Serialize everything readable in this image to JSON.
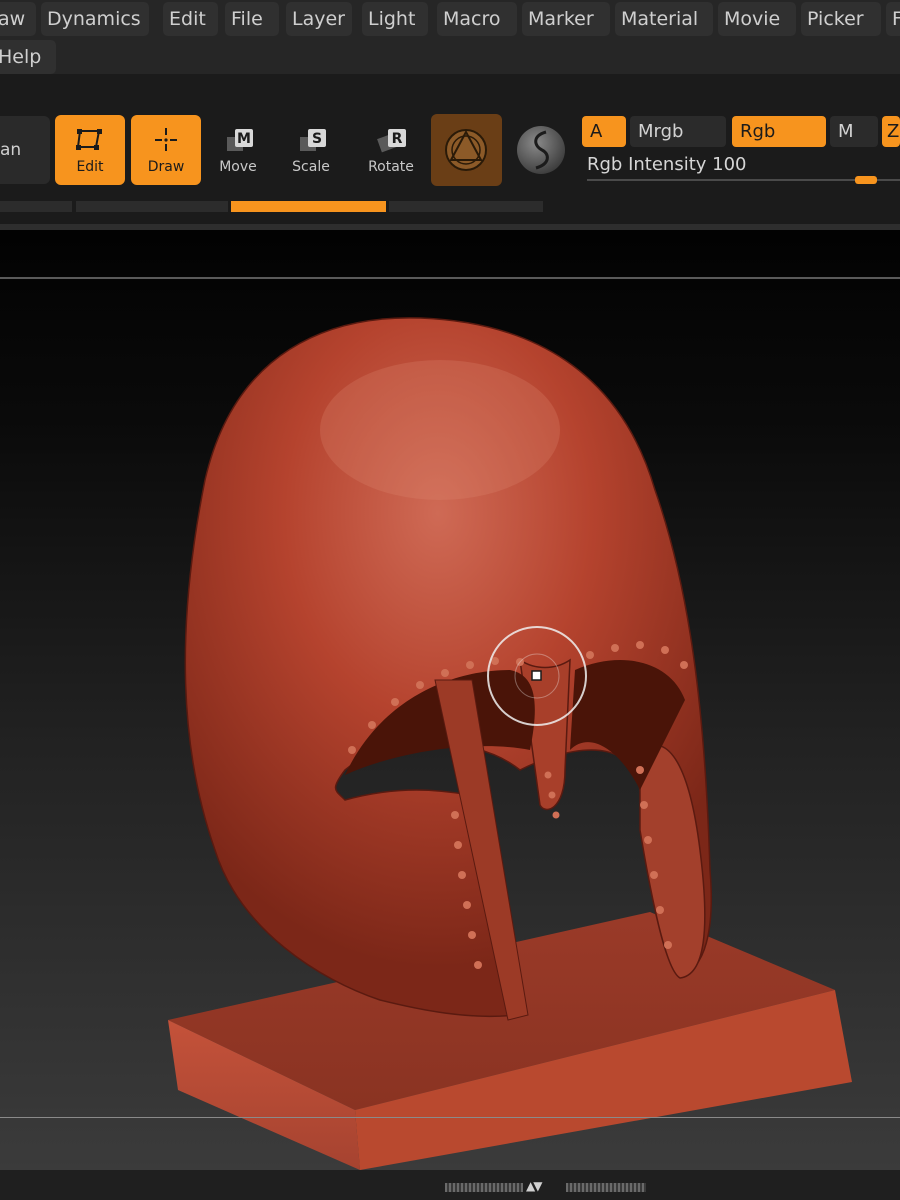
{
  "menu": {
    "row1": [
      "aw",
      "Dynamics",
      "Edit",
      "File",
      "Layer",
      "Light",
      "Macro",
      "Marker",
      "Material",
      "Movie",
      "Picker",
      "F"
    ],
    "row2": [
      "Help"
    ]
  },
  "toolbar": {
    "left_stub_label": "an",
    "tools": [
      {
        "label": "Edit",
        "icon": "edit-frame-icon",
        "state": "on"
      },
      {
        "label": "Draw",
        "icon": "draw-crosshair-icon",
        "state": "on"
      },
      {
        "label": "Move",
        "icon": "move-m-icon",
        "state": "off"
      },
      {
        "label": "Scale",
        "icon": "scale-s-icon",
        "state": "off"
      },
      {
        "label": "Rotate",
        "icon": "rotate-r-icon",
        "state": "off"
      }
    ],
    "material_icon": "material-sphere-icon",
    "texture_icon": "texture-sphere-icon",
    "chips": [
      {
        "label": "A",
        "state": "on"
      },
      {
        "label": "Mrgb",
        "state": "off"
      },
      {
        "label": "Rgb",
        "state": "on"
      },
      {
        "label": "M",
        "state": "off"
      },
      {
        "label": "Z",
        "state": "on"
      }
    ],
    "intensity_label": "Rgb Intensity 100",
    "intensity_value": 100
  },
  "colors": {
    "accent": "#f7941e",
    "clay": "#b5432e",
    "background": "#1e1e1e"
  },
  "canvas": {
    "model_name": "helmet-sculpt",
    "brush_cursor_icon": "brush-circle-cursor-icon"
  },
  "bottombar": {
    "collapse_icon": "expand-collapse-arrows-icon",
    "arrows": "▲▼"
  }
}
